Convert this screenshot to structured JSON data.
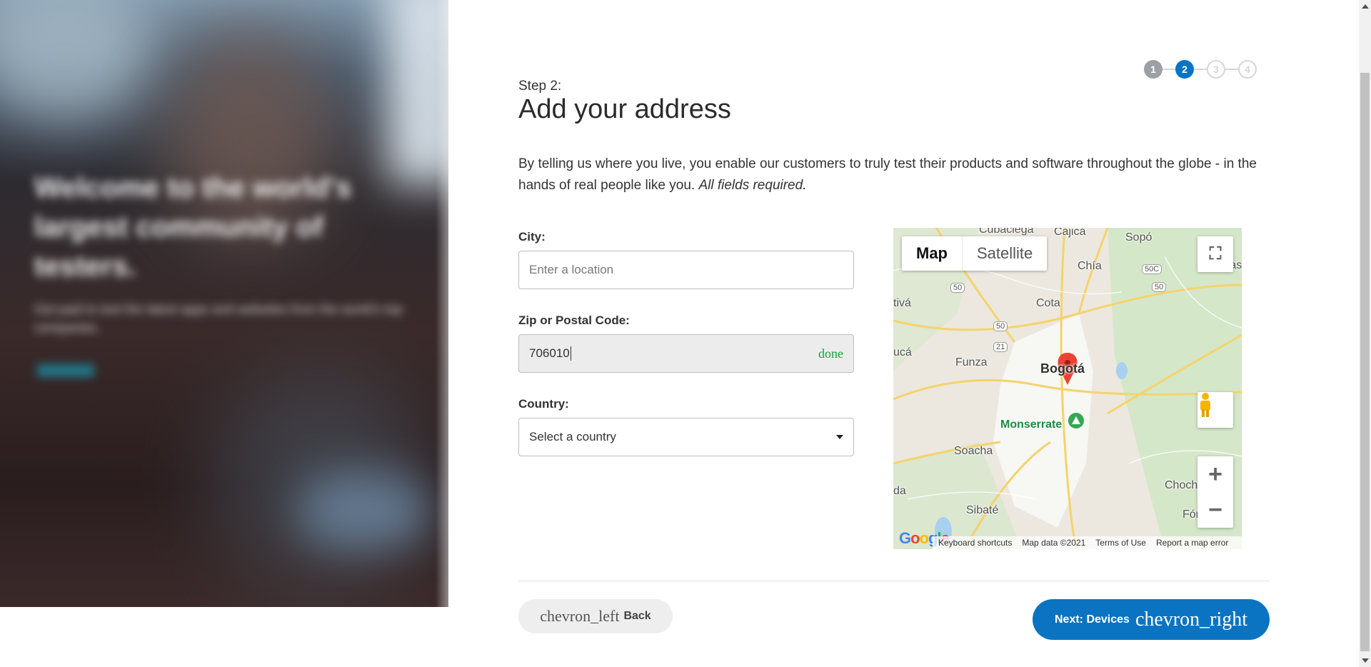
{
  "stepper": {
    "steps": [
      "1",
      "2",
      "3",
      "4"
    ],
    "current": 2
  },
  "header": {
    "step_label": "Step 2:",
    "title": "Add your address"
  },
  "intro": {
    "text": "By telling us where you live, you enable our customers to truly test their products and software throughout the globe - in the hands of real people like you.",
    "emphasis": "All fields required."
  },
  "form": {
    "city": {
      "label": "City:",
      "placeholder": "Enter a location"
    },
    "zip": {
      "label": "Zip or Postal Code:",
      "value": "706010",
      "status": "done"
    },
    "country": {
      "label": "Country:",
      "value": "Select a country"
    }
  },
  "map": {
    "tabs": [
      "Map",
      "Satellite"
    ],
    "places": [
      "Cajicá",
      "Sopó",
      "Chía",
      "Guas",
      "Cota",
      "Funza",
      "Bogotá",
      "Monserrate",
      "Soacha",
      "Sibaté",
      "Chochí",
      "Fómeque",
      "Cubaciega",
      "tivá",
      "ucá",
      "da"
    ],
    "road_shields": [
      "50",
      "50",
      "50",
      "21",
      "50",
      "50C",
      "50"
    ],
    "footer": [
      "Keyboard shortcuts",
      "Map data ©2021",
      "Terms of Use",
      "Report a map error"
    ],
    "logo": "Google"
  },
  "nav": {
    "back": {
      "glyph": "chevron_left",
      "label": "Back"
    },
    "next": {
      "label": "Next: Devices",
      "glyph": "chevron_right"
    }
  },
  "colors": {
    "primary": "#0a74c2",
    "done": "#1aa034"
  }
}
